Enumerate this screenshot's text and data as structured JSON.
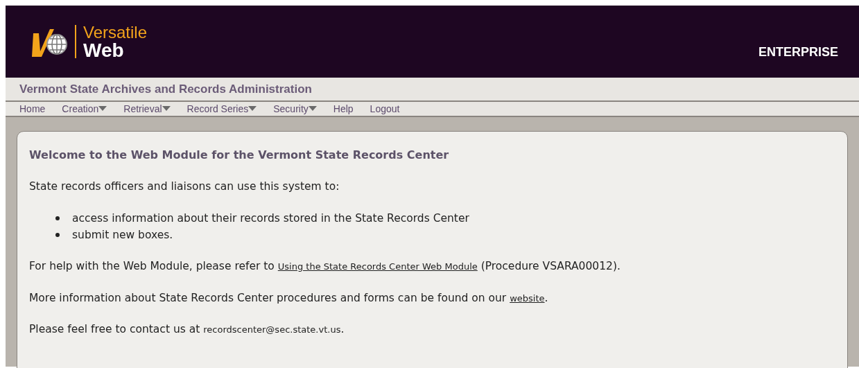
{
  "header": {
    "logo_top": "Versatile",
    "logo_bottom": "Web",
    "edition": "ENTERPRISE"
  },
  "org_title": "Vermont State Archives and Records Administration",
  "nav": [
    {
      "label": "Home",
      "dropdown": false
    },
    {
      "label": "Creation",
      "dropdown": true
    },
    {
      "label": "Retrieval",
      "dropdown": true
    },
    {
      "label": "Record Series",
      "dropdown": true
    },
    {
      "label": "Security",
      "dropdown": true
    },
    {
      "label": "Help",
      "dropdown": false
    },
    {
      "label": "Logout",
      "dropdown": false
    }
  ],
  "panel": {
    "heading": "Welcome to the Web Module for the Vermont State Records Center",
    "blocks": [
      {
        "kind": "paragraph",
        "parts": [
          {
            "kind": "text",
            "text": "State records officers and liaisons can use this system to:"
          }
        ]
      },
      {
        "kind": "list",
        "items": [
          "access information about their records stored in the State Records Center",
          "submit new boxes."
        ]
      },
      {
        "kind": "paragraph",
        "parts": [
          {
            "kind": "text",
            "text": "For help with the Web Module, please refer to "
          },
          {
            "kind": "link",
            "text": "Using the State Records Center Web Module"
          },
          {
            "kind": "text",
            "text": " (Procedure VSARA00012)."
          }
        ]
      },
      {
        "kind": "paragraph",
        "parts": [
          {
            "kind": "text",
            "text": "More information about State Records Center procedures and forms can be found on our "
          },
          {
            "kind": "link",
            "text": "website"
          },
          {
            "kind": "text",
            "text": "."
          }
        ]
      },
      {
        "kind": "paragraph",
        "parts": [
          {
            "kind": "text",
            "text": "Please feel free to contact us at "
          },
          {
            "kind": "email",
            "text": "recordscenter@sec.state.vt.us"
          },
          {
            "kind": "text",
            "text": "."
          }
        ]
      }
    ]
  }
}
